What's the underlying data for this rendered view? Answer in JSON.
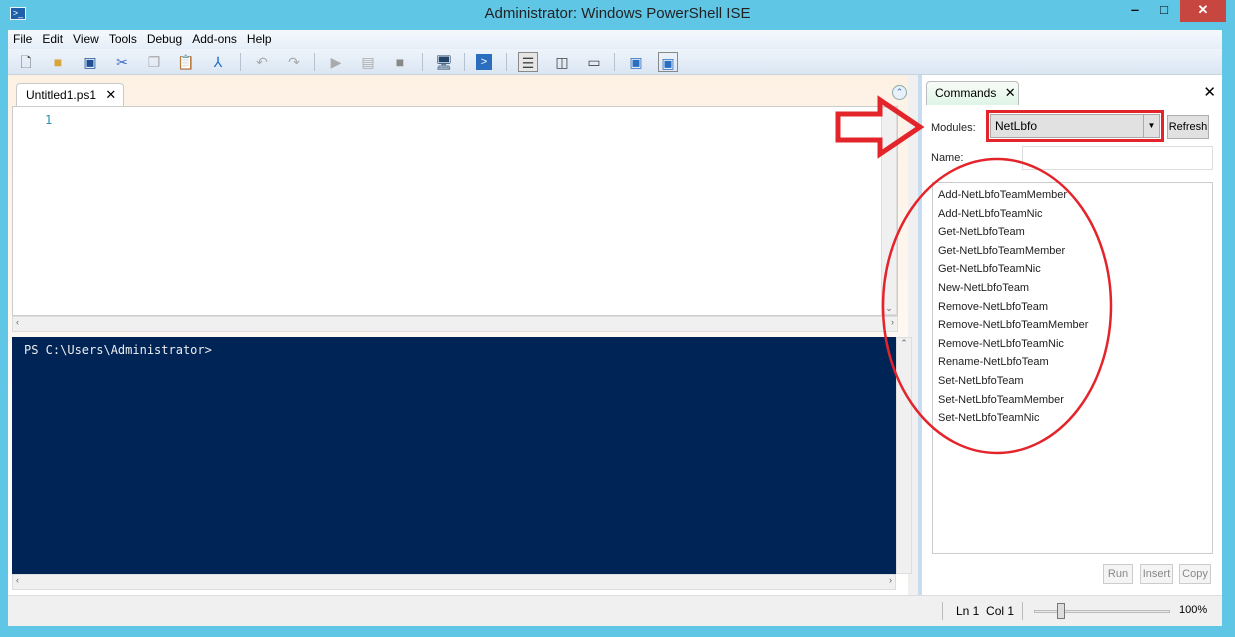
{
  "window": {
    "title": "Administrator: Windows PowerShell ISE",
    "app_icon": ">_"
  },
  "menu": [
    "File",
    "Edit",
    "View",
    "Tools",
    "Debug",
    "Add-ons",
    "Help"
  ],
  "toolbar": [
    "new-icon",
    "open-icon",
    "save-icon",
    "cut-icon",
    "copy-icon",
    "paste-icon",
    "clear-console-icon",
    "undo-icon",
    "redo-icon",
    "run-icon",
    "run-selection-icon",
    "stop-icon",
    "remote-powershell-icon",
    "powershell-icon",
    "show-script-top-icon",
    "show-script-right-icon",
    "show-script-max-icon",
    "show-command-window-icon",
    "show-command-addon-icon"
  ],
  "script": {
    "tab": "Untitled1.ps1",
    "line_number": "1"
  },
  "console": {
    "prompt": "PS C:\\Users\\Administrator>"
  },
  "commands": {
    "tab": "Commands",
    "modules_label": "Modules:",
    "module_value": "NetLbfo",
    "refresh": "Refresh",
    "name_label": "Name:",
    "name_value": "",
    "items": [
      "Add-NetLbfoTeamMember",
      "Add-NetLbfoTeamNic",
      "Get-NetLbfoTeam",
      "Get-NetLbfoTeamMember",
      "Get-NetLbfoTeamNic",
      "New-NetLbfoTeam",
      "Remove-NetLbfoTeam",
      "Remove-NetLbfoTeamMember",
      "Remove-NetLbfoTeamNic",
      "Rename-NetLbfoTeam",
      "Set-NetLbfoTeam",
      "Set-NetLbfoTeamMember",
      "Set-NetLbfoTeamNic"
    ],
    "run": "Run",
    "insert": "Insert",
    "copy": "Copy"
  },
  "status": {
    "position": "Ln 1  Col 1",
    "zoom": "100%",
    "zoom_slider_fraction": 0.2
  },
  "annotation_color": "#e3252b"
}
